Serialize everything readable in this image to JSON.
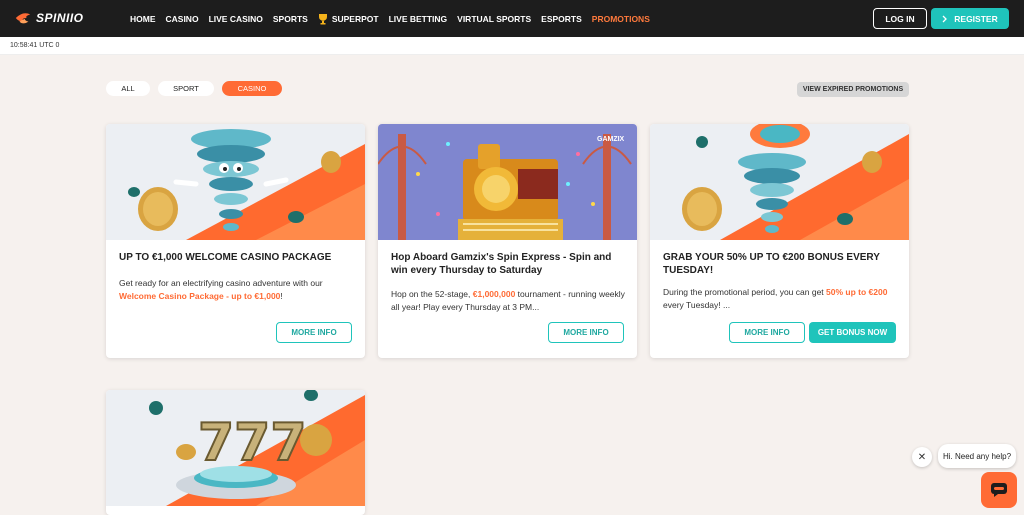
{
  "header": {
    "logo_text": "SPINIIO",
    "nav": [
      {
        "label": "HOME"
      },
      {
        "label": "CASINO"
      },
      {
        "label": "LIVE CASINO"
      },
      {
        "label": "SPORTS"
      },
      {
        "label": "SUPERPOT"
      },
      {
        "label": "LIVE BETTING"
      },
      {
        "label": "VIRTUAL SPORTS"
      },
      {
        "label": "ESPORTS"
      },
      {
        "label": "PROMOTIONS"
      }
    ],
    "login_label": "LOG IN",
    "register_label": "REGISTER"
  },
  "time": "10:58:41 UTC 0",
  "filters": {
    "all": "ALL",
    "sport": "SPORT",
    "casino": "CASINO",
    "expired": "VIEW EXPIRED PROMOTIONS"
  },
  "cards": [
    {
      "title": "UP TO €1,000 WELCOME CASINO PACKAGE",
      "desc_pre": "Get ready for an electrifying casino adventure with our ",
      "desc_hl": "Welcome Casino Package - up to €1,000",
      "desc_post": "!",
      "more_info": "MORE INFO"
    },
    {
      "title": "Hop Aboard Gamzix's Spin Express - Spin and win every Thursday to Saturday",
      "image_label": "GAMZIX",
      "desc_pre": "Hop on the 52-stage, ",
      "desc_hl": "€1,000,000",
      "desc_post": " tournament - running weekly all year! Play every Thursday at 3 PM...",
      "more_info": "MORE INFO"
    },
    {
      "title": "GRAB YOUR 50% UP TO €200 BONUS EVERY TUESDAY!",
      "desc_pre": "During the promotional period, you can get ",
      "desc_hl": "50% up to €200",
      "desc_post": " every Tuesday! ...",
      "more_info": "MORE INFO",
      "bonus": "GET BONUS NOW"
    }
  ],
  "chat": {
    "close": "✕",
    "message": "Hi. Need any help?"
  },
  "colors": {
    "accent_orange": "#ff6b35",
    "accent_teal": "#1fc4bb",
    "header_bg": "#1d1d1d"
  }
}
